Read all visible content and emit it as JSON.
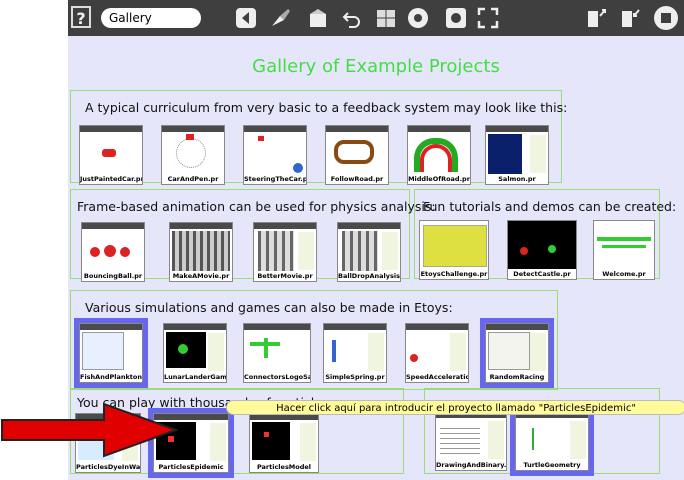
{
  "toolbar": {
    "help": "?",
    "project_name": "Gallery"
  },
  "page_title": "Gallery of Example Projects",
  "sections": [
    {
      "caption": "A typical curriculum from very basic to a feedback system may look like this:",
      "projects": [
        "JustPaintedCar.pr",
        "CarAndPen.pr",
        "SteeringTheCar.pr",
        "FollowRoad.pr",
        "MiddleOfRoad.pr",
        "Salmon.pr"
      ]
    },
    {
      "caption": "Frame-based animation can be used for physics analysis:",
      "projects": [
        "BouncingBall.pr",
        "MakeAMovie.pr",
        "BetterMovie.pr",
        "BallDropAnalysis.pr"
      ]
    },
    {
      "caption": "Fun tutorials and demos can be created:",
      "projects": [
        "EtoysChallenge.pr",
        "DetectCastle.pr",
        "Welcome.pr"
      ]
    },
    {
      "caption": "Various simulations and games can also be made in Etoys:",
      "projects": [
        "FishAndPlankton",
        "LunarLanderGame.pr",
        "ConnectorsLogoSample.pr",
        "SimpleSpring.pr",
        "SpeedAcceleration.pr",
        "RandomRacing"
      ]
    },
    {
      "caption": "You can play with thousands of particles:",
      "projects": [
        "ParticlesDyeInWater",
        "ParticlesEpidemic",
        "ParticlesModel"
      ]
    },
    {
      "caption": "",
      "projects": [
        "DrawingAndBinary.pr",
        "TurtleGeometry"
      ]
    }
  ],
  "tooltip": "Hacer click aquí para introducir el proyecto llamado \"ParticlesEpidemic\"",
  "colors": {
    "accent_title": "#44dd44",
    "selection": "#6666ee",
    "arrow": "#e00000"
  }
}
